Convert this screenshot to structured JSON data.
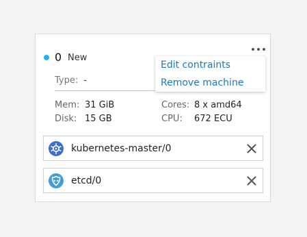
{
  "machine": {
    "id": "0",
    "status": "New",
    "status_color": "#19b6ee",
    "type_label": "Type:",
    "type_value": "-"
  },
  "menu": {
    "items": [
      {
        "label": "Edit contraints"
      },
      {
        "label": "Remove machine"
      }
    ]
  },
  "specs": {
    "mem_label": "Mem:",
    "mem_value": "31 GiB",
    "disk_label": "Disk:",
    "disk_value": "15 GB",
    "cores_label": "Cores:",
    "cores_value": "8 x amd64",
    "cpu_label": "CPU:",
    "cpu_value": "672 ECU"
  },
  "applications": [
    {
      "name": "kubernetes-master/0",
      "icon": "kubernetes-icon",
      "icon_color": "#3b6fd6"
    },
    {
      "name": "etcd/0",
      "icon": "etcd-icon",
      "icon_color": "#419eda"
    }
  ],
  "colors": {
    "link": "#1d78b4",
    "background": "#f2f2f2"
  }
}
